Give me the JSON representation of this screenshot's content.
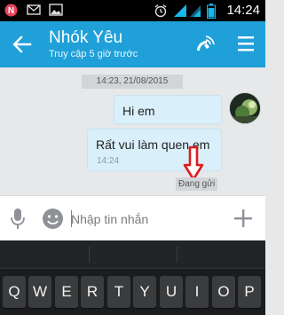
{
  "status_bar": {
    "time": "14:24",
    "icons": [
      "notification-n-icon",
      "email-icon",
      "gallery-icon",
      "alarm-icon",
      "signal-icon",
      "wifi-icon",
      "battery-icon"
    ]
  },
  "app_bar": {
    "title": "Nhók Yêu",
    "subtitle": "Truy cập 5 giờ trước",
    "color": "#1fa0d8"
  },
  "chat": {
    "date_stamp": "14:23, 21/08/2015",
    "messages": [
      {
        "text": "Hi em"
      },
      {
        "text": "Rất vui làm quen em",
        "time": "14:24"
      }
    ],
    "status": "Đang gửi"
  },
  "input": {
    "placeholder": "Nhập tin nhắn"
  },
  "keyboard": {
    "keys": [
      "Q",
      "W",
      "E",
      "R",
      "T",
      "Y",
      "U",
      "I",
      "O",
      "P"
    ]
  }
}
